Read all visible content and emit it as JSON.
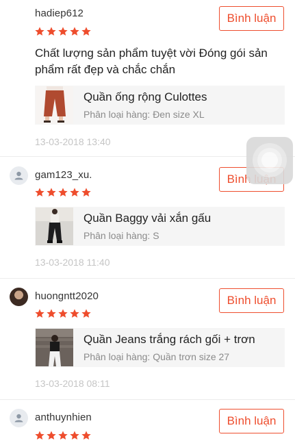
{
  "accent_color": "#ee4d2d",
  "reviews": [
    {
      "username": "hadiep612",
      "rating": 5,
      "reply_label": "Bình luận",
      "comment": "Chất lượng sản phẩm tuyệt vời Đóng gói sản phẩm rất đẹp và chắc chắn",
      "product_name": "Quần ống rộng Culottes",
      "variant": "Phân loại hàng: Đen size XL",
      "date": "13-03-2018 13:40"
    },
    {
      "username": "gam123_xu.",
      "rating": 5,
      "reply_label": "Bình luận",
      "comment": "",
      "product_name": "Quần Baggy vải xắn gấu",
      "variant": "Phân loại hàng: S",
      "date": "13-03-2018 11:40"
    },
    {
      "username": "huongntt2020",
      "rating": 5,
      "reply_label": "Bình luận",
      "comment": "",
      "product_name": "Quần Jeans trắng rách gối + trơn",
      "variant": "Phân loại hàng: Quần trơn size 27",
      "date": "13-03-2018 08:11"
    },
    {
      "username": "anthuynhien",
      "rating": 5,
      "reply_label": "Bình luận"
    }
  ]
}
